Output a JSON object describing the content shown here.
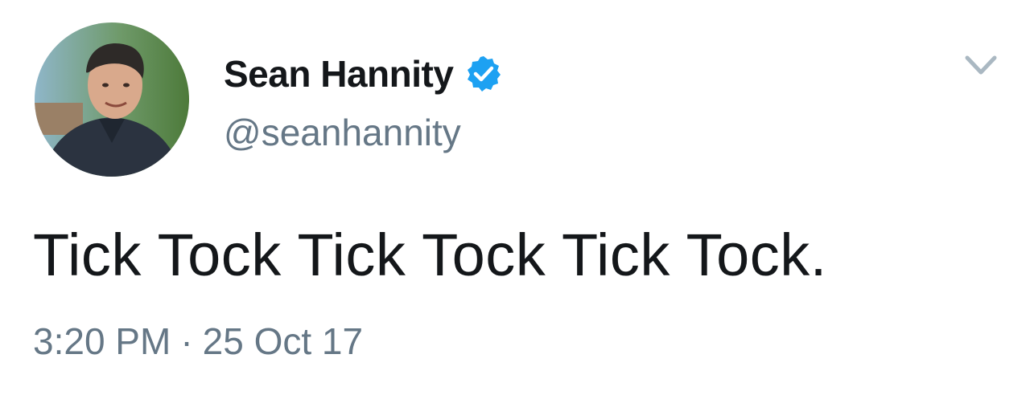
{
  "tweet": {
    "author": {
      "display_name": "Sean Hannity",
      "handle": "@seanhannity",
      "verified": true,
      "avatar_icon": "profile-photo"
    },
    "text": "Tick Tock Tick Tock Tick Tock.",
    "time": "3:20 PM",
    "separator": "·",
    "date": "25 Oct 17",
    "menu_icon": "chevron-down-icon"
  },
  "colors": {
    "primary_text": "#14171a",
    "secondary_text": "#657786",
    "verified_blue": "#1da1f2",
    "caret": "#aab8c2"
  }
}
